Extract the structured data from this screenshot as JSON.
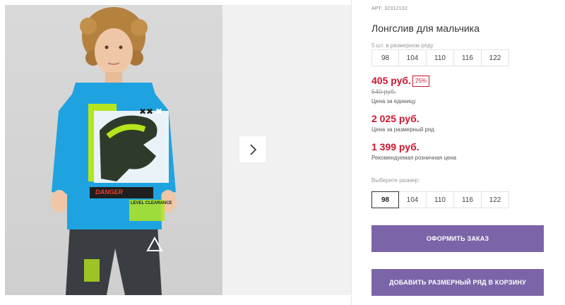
{
  "product": {
    "sku": "АРТ: 32312102",
    "title": "Лонгслив для мальчика",
    "set_label": "5 шт. в размерном ряду",
    "set_sizes": [
      "98",
      "104",
      "110",
      "116",
      "122"
    ],
    "price": "405 руб.",
    "discount": "25%",
    "old_price": "540 руб.",
    "unit_price_note": "Цена за единицу",
    "set_price": "2 025 руб.",
    "set_price_note": "Цена за размерный ряд",
    "rrp_price": "1 399 руб.",
    "rrp_note": "Рекомендуемая розничная цена",
    "choose_size_label": "Выберите размер:",
    "size_options": [
      "98",
      "104",
      "110",
      "116",
      "122"
    ],
    "selected_size": "98"
  },
  "photo": {
    "shirt_print_text": "DANGER",
    "shirt_small_text": "LEVEL CLEARANCE"
  },
  "buttons": {
    "order": "Оформить заказ",
    "add_set_to_cart": "Добавить размерный ряд в корзину"
  },
  "colors": {
    "accent_button": "#7b65a8",
    "price_red": "#d0152f",
    "shirt_blue": "#1fa3e0",
    "print_green": "#b5e61d"
  },
  "icons": {
    "gallery_next": "chevron-right-icon"
  }
}
